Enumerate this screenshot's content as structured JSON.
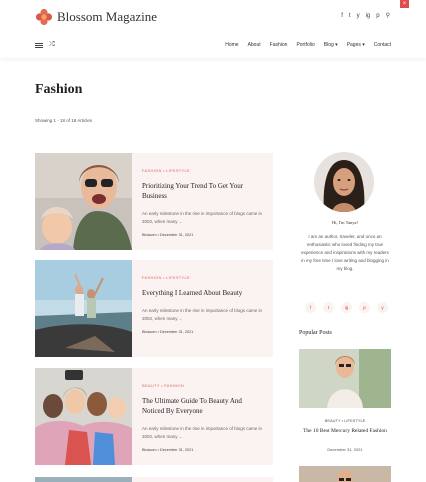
{
  "header": {
    "site_title": "Blossom Magazine",
    "socials": [
      "f",
      "t",
      "y",
      "ig",
      "p",
      "s"
    ],
    "search_icon": "search-icon",
    "nav": [
      "Home",
      "About",
      "Fashion",
      "Portfolio",
      "Blog ▾",
      "Pages ▾",
      "Contact"
    ]
  },
  "archive": {
    "title": "Fashion",
    "count_text": "Showing 1 - 18 of 18 Articles"
  },
  "posts": [
    {
      "category": "FASHION  •  LIFESTYLE",
      "title": "Prioritizing Your Trend To Get Your Business",
      "excerpt": "An early milestone in the rise in importance of blogs came in 2002, when many ...",
      "meta": "Blossom  •  December 31, 2021"
    },
    {
      "category": "FASHION  •  LIFESTYLE",
      "title": "Everything I Learned About Beauty",
      "excerpt": "An early milestone in the rise in importance of blogs came in 2002, when many ...",
      "meta": "Blossom  •  December 31, 2021"
    },
    {
      "category": "BEAUTY  •  FASHION",
      "title": "The Ultimate Guide To Beauty And Noticed By Everyone",
      "excerpt": "An early milestone in the rise in importance of blogs came in 2002, when many ...",
      "meta": "Blossom  •  December 31, 2021"
    }
  ],
  "sidebar": {
    "greeting": "Hi, I'm Tanya!",
    "bio": "I am an author, traveler, and once an enthusiastic who loved finding my true experience and inspirations with my readers in my free time I love writing and blogging in my blog.",
    "socials": [
      "f",
      "t",
      "ig",
      "p",
      "y"
    ],
    "popular_heading": "Popular Posts",
    "popular_post": {
      "category": "BEAUTY  •  LIFESTYLE",
      "title": "The 10 Best Mercury Related Fashion",
      "date": "December 31, 2021"
    }
  }
}
